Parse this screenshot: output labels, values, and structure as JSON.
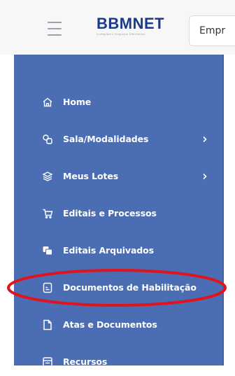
{
  "header": {
    "logo_text": "BBMNET",
    "logo_sub": "Licitações e Negócios Eletrônicos",
    "tab_label": "Empr"
  },
  "sidebar": {
    "items": [
      {
        "label": "Home",
        "icon": "home-icon"
      },
      {
        "label": "Sala/Modalidades",
        "icon": "rooms-icon",
        "chevron": true
      },
      {
        "label": "Meus Lotes",
        "icon": "layers-icon",
        "chevron": true
      },
      {
        "label": "Editais e Processos",
        "icon": "cart-icon"
      },
      {
        "label": "Editais Arquivados",
        "icon": "archive-icon"
      },
      {
        "label": "Documentos de Habilitação",
        "icon": "document-icon"
      },
      {
        "label": "Atas e Documentos",
        "icon": "file-icon"
      },
      {
        "label": "Recursos",
        "icon": "form-icon"
      }
    ]
  },
  "colors": {
    "sidebar_bg": "#4a6db3",
    "logo": "#1c3a8a",
    "highlight": "#e1131c"
  }
}
